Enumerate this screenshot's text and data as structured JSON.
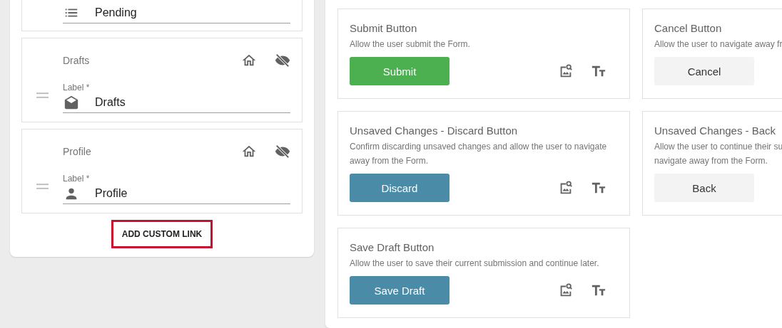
{
  "links": [
    {
      "value": "Pending"
    },
    {
      "title": "Drafts",
      "label": "Label *",
      "value": "Drafts",
      "visible": false
    },
    {
      "title": "Profile",
      "label": "Label *",
      "value": "Profile",
      "visible": false
    }
  ],
  "add_link": "ADD CUSTOM LINK",
  "buttons": [
    {
      "title": "Submit Button",
      "description_lines": [
        "Allow the user submit the Form."
      ],
      "button": "Submit",
      "kind": "success"
    },
    {
      "title": "Cancel Button",
      "description_lines": [
        "Allow the user to navigate away fr"
      ],
      "button": "Cancel",
      "kind": "plain"
    },
    {
      "title": "Unsaved Changes - Discard Button",
      "description_lines": [
        "Confirm discarding unsaved changes and allow the user to navigate away from the Form."
      ],
      "button": "Discard",
      "kind": "primary"
    },
    {
      "title": "Unsaved Changes - Back",
      "description_lines": [
        "Allow the user to continue their su",
        "navigate away from the Form."
      ],
      "button": "Back",
      "kind": "plain"
    },
    {
      "title": "Save Draft Button",
      "description_lines": [
        "Allow the user to save their current submission and continue later."
      ],
      "button": "Save Draft",
      "kind": "primary"
    }
  ]
}
